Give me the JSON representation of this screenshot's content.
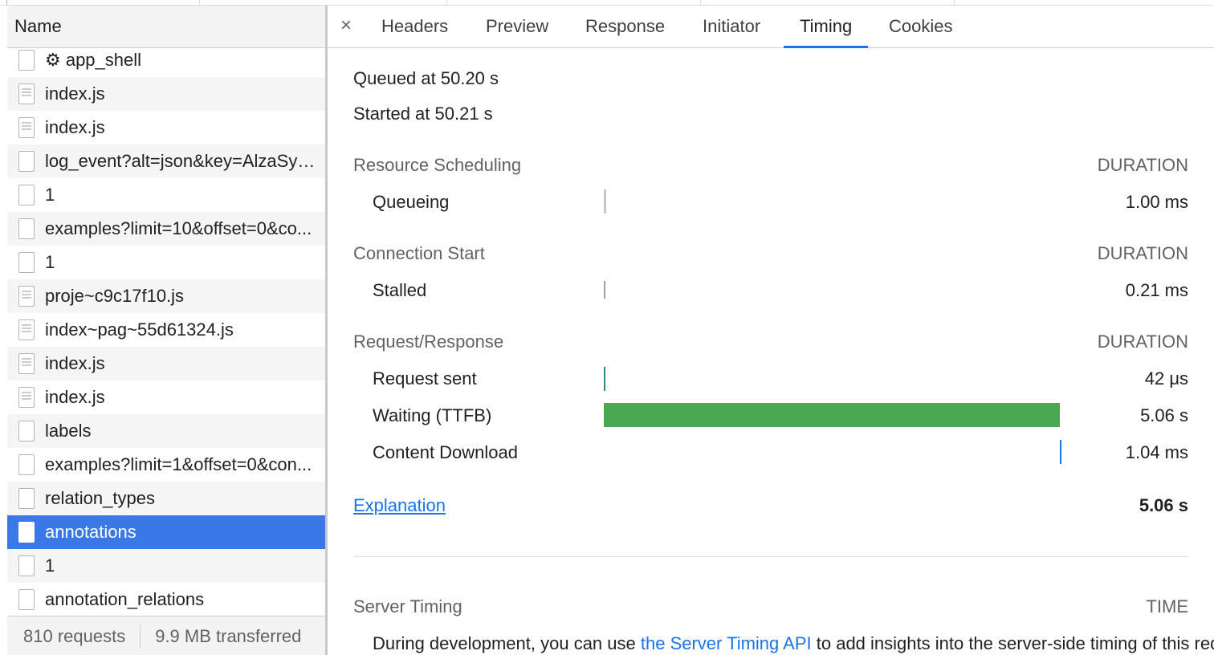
{
  "left_panel": {
    "header": "Name",
    "rows": [
      {
        "name": "⚙ app_shell",
        "icon": "doc"
      },
      {
        "name": "index.js",
        "icon": "js"
      },
      {
        "name": "index.js",
        "icon": "js"
      },
      {
        "name": "log_event?alt=json&key=AlzaSyBXd...",
        "icon": "doc"
      },
      {
        "name": "1",
        "icon": "doc"
      },
      {
        "name": "examples?limit=10&offset=0&co...",
        "icon": "doc"
      },
      {
        "name": "1",
        "icon": "doc"
      },
      {
        "name": "proje~c9c17f10.js",
        "icon": "js"
      },
      {
        "name": "index~pag~55d61324.js",
        "icon": "js"
      },
      {
        "name": "index.js",
        "icon": "js"
      },
      {
        "name": "index.js",
        "icon": "js"
      },
      {
        "name": "labels",
        "icon": "doc"
      },
      {
        "name": "examples?limit=1&offset=0&con...",
        "icon": "doc"
      },
      {
        "name": "relation_types",
        "icon": "doc"
      },
      {
        "name": "annotations",
        "icon": "doc",
        "selected": true
      },
      {
        "name": "1",
        "icon": "doc"
      },
      {
        "name": "annotation_relations",
        "icon": "doc"
      }
    ],
    "footer": {
      "requests": "810 requests",
      "transferred": "9.9 MB transferred"
    }
  },
  "tabs": {
    "close": "×",
    "items": [
      "Headers",
      "Preview",
      "Response",
      "Initiator",
      "Timing",
      "Cookies"
    ],
    "active": "Timing"
  },
  "timing": {
    "queued": "Queued at 50.20 s",
    "started": "Started at 50.21 s",
    "duration_label": "DURATION",
    "sections": [
      {
        "title": "Resource Scheduling",
        "rows": [
          {
            "label": "Queueing",
            "value": "1.00 ms"
          }
        ]
      },
      {
        "title": "Connection Start",
        "rows": [
          {
            "label": "Stalled",
            "value": "0.21 ms"
          }
        ]
      },
      {
        "title": "Request/Response",
        "rows": [
          {
            "label": "Request sent",
            "value": "42 μs"
          },
          {
            "label": "Waiting (TTFB)",
            "value": "5.06 s"
          },
          {
            "label": "Content Download",
            "value": "1.04 ms"
          }
        ]
      }
    ],
    "explanation": "Explanation",
    "total": "5.06 s",
    "server_timing": {
      "title": "Server Timing",
      "time_label": "TIME",
      "text_before": "During development, you can use ",
      "link": "the Server Timing API",
      "text_after": " to add insights into the server-side timing of this request."
    }
  },
  "colors": {
    "accent": "#1a73e8",
    "selected_row": "#3b78e7",
    "ttfb_bar": "#4aa853"
  }
}
